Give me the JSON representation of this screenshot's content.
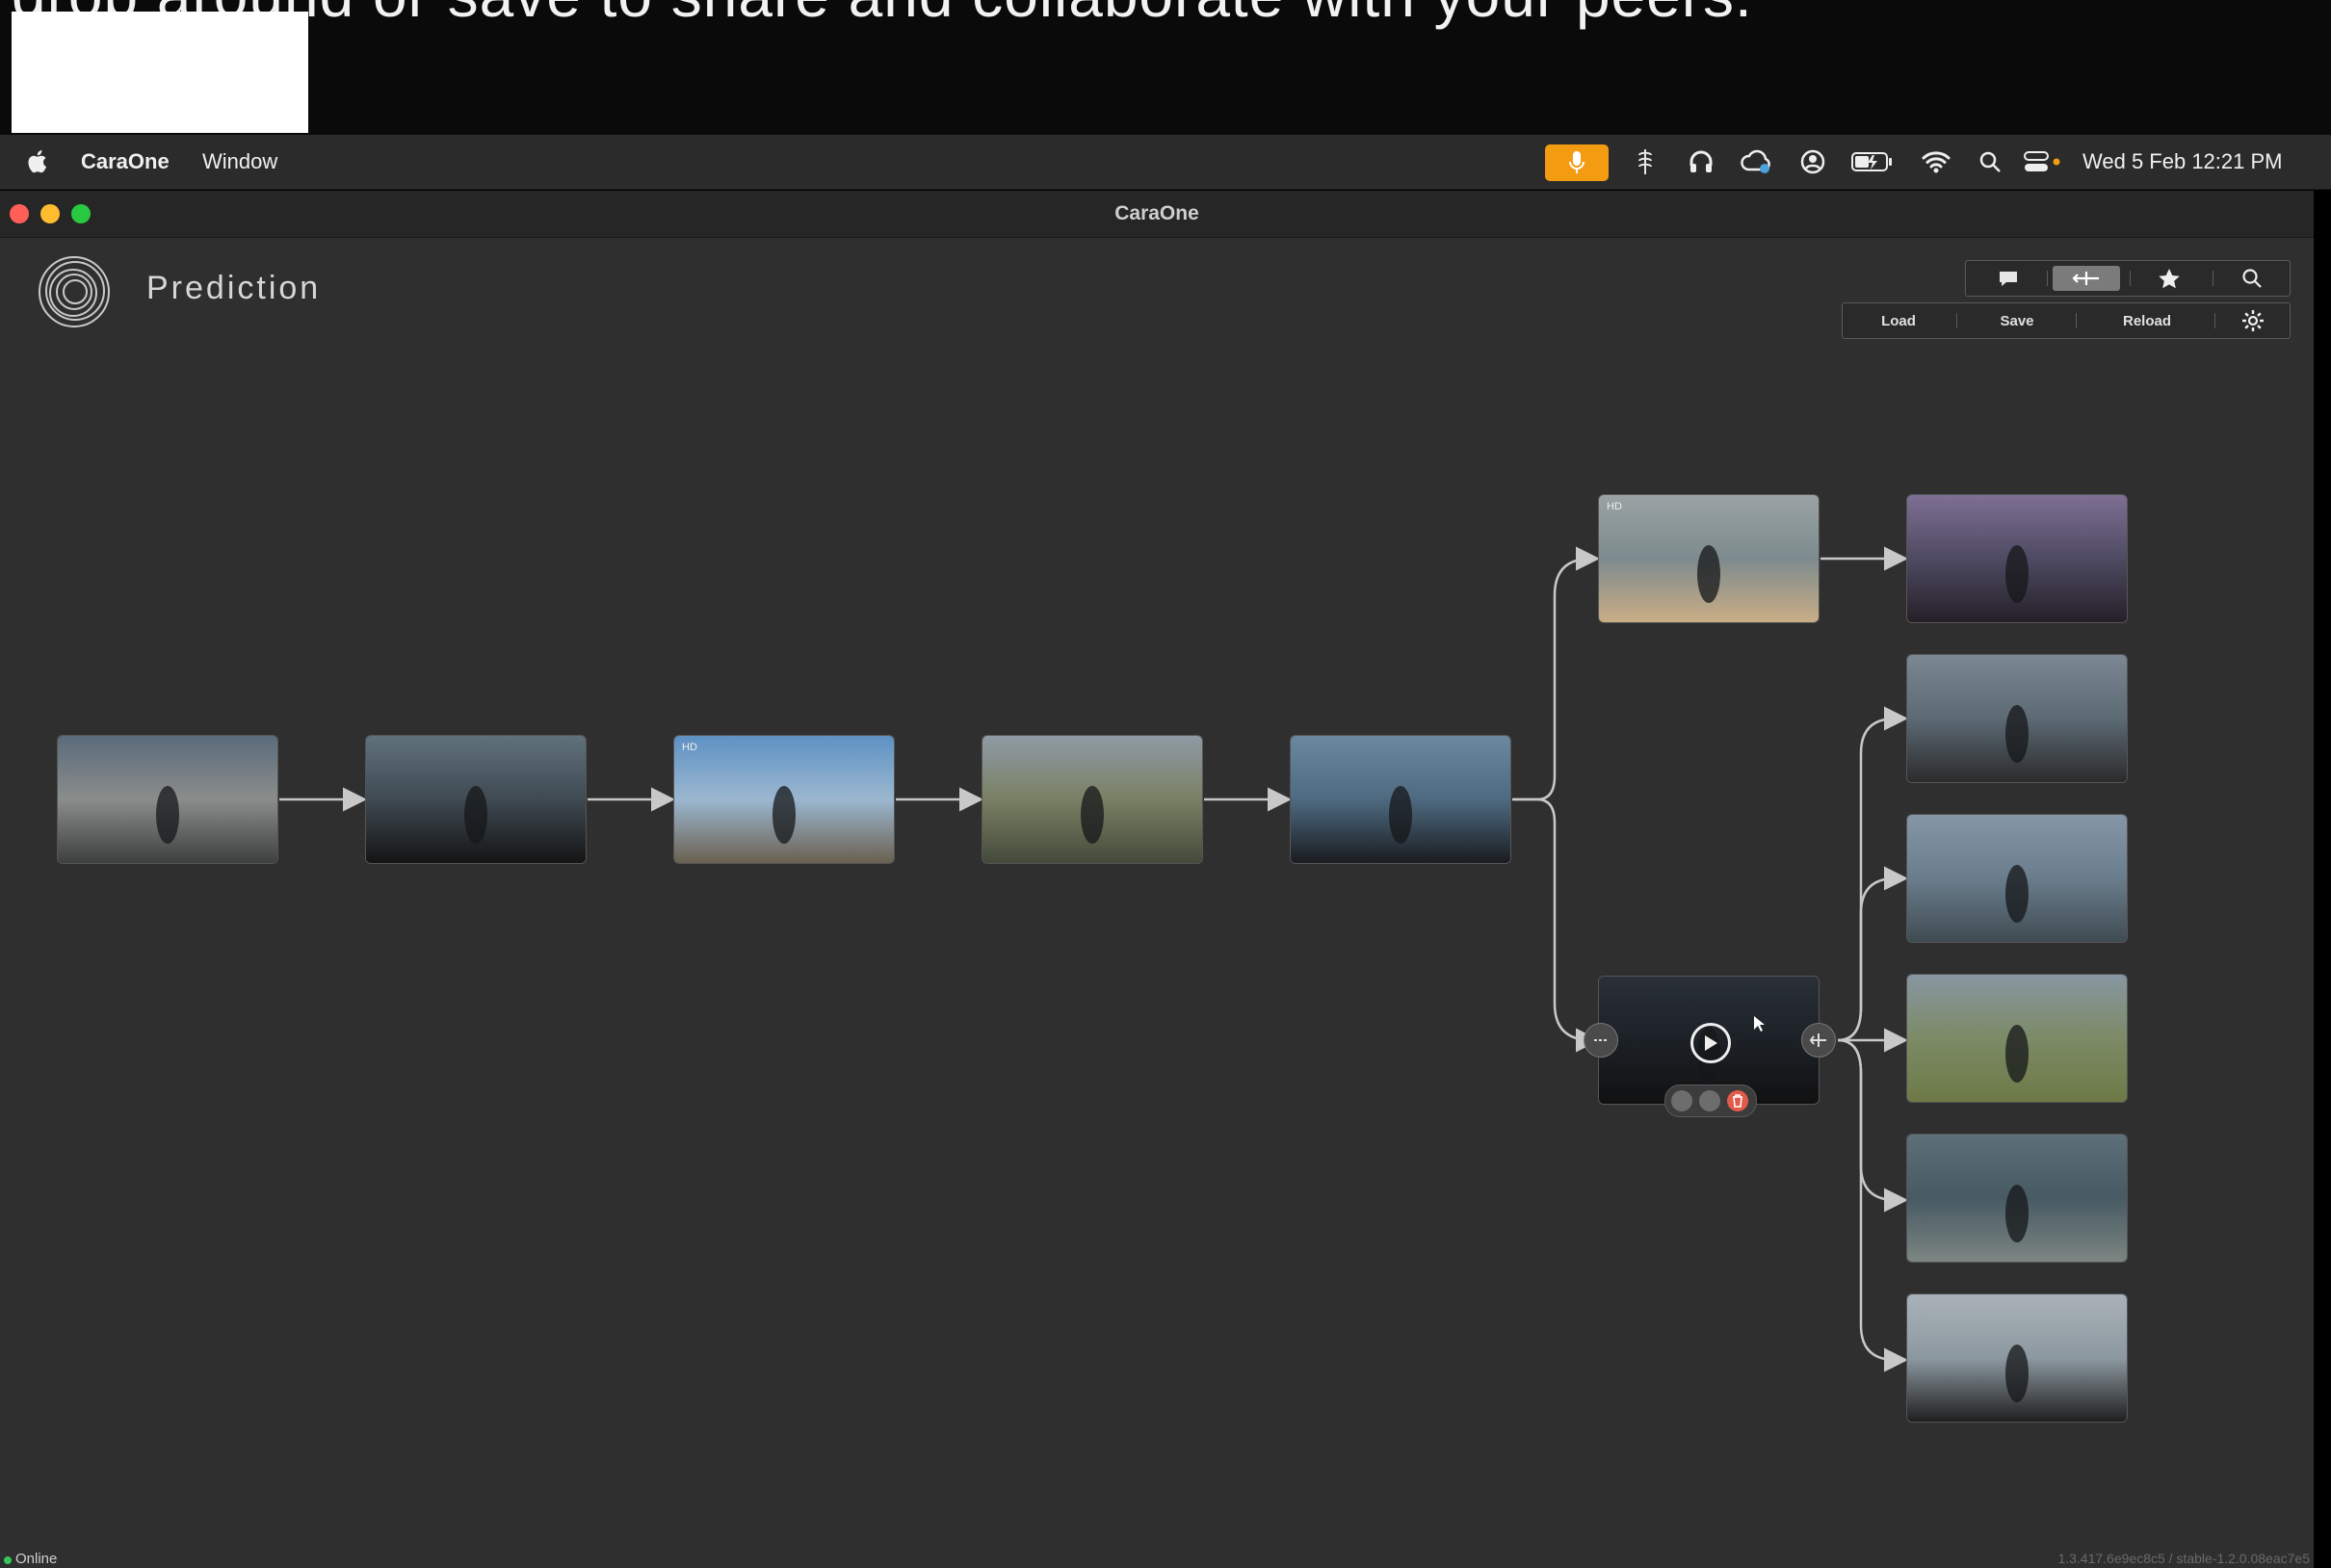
{
  "caption": {
    "text": "drop around or save to share and collaborate with your peers."
  },
  "menubar": {
    "app_name": "CaraOne",
    "menu_window": "Window",
    "clock": "Wed 5 Feb  12:21 PM",
    "icons": [
      "apple-icon",
      "microphone-icon",
      "drive-icon",
      "headphones-icon",
      "cloud-sync-icon",
      "user-icon",
      "battery-icon",
      "wifi-icon",
      "search-icon",
      "control-center-icon"
    ]
  },
  "window": {
    "title": "CaraOne"
  },
  "app": {
    "title": "Prediction",
    "logo_icon": "caraone-logo-icon"
  },
  "toolbar_top": {
    "icons": [
      "comment-icon",
      "compare-icon",
      "star-icon",
      "search-icon"
    ],
    "active_index": 1
  },
  "toolbar_bottom": {
    "load": "Load",
    "save": "Save",
    "reload": "Reload",
    "settings_icon": "gear-icon"
  },
  "graph": {
    "nodes": [
      {
        "id": "n1",
        "scene": "figure on beach with hills",
        "colors": [
          "#5b6b7a",
          "#8a8d8c",
          "#3d403f"
        ]
      },
      {
        "id": "n2",
        "scene": "man in hat profile",
        "colors": [
          "#60717c",
          "#3f4a52",
          "#141414"
        ]
      },
      {
        "id": "n3",
        "scene": "rocky coast waves",
        "colors": [
          "#5e91c4",
          "#9bb7cf",
          "#6a6050"
        ],
        "badge": "HD"
      },
      {
        "id": "n4",
        "scene": "man in tall grass",
        "colors": [
          "#8e9aa6",
          "#7a8064",
          "#444a3a"
        ]
      },
      {
        "id": "n5",
        "scene": "man facing lighthouse",
        "colors": [
          "#6b889f",
          "#4e6a80",
          "#1a1c20"
        ]
      },
      {
        "id": "n6",
        "scene": "aerial beach",
        "colors": [
          "#9aa3a4",
          "#7d8b8e",
          "#c9ad85"
        ],
        "badge": "HD"
      },
      {
        "id": "n7",
        "scene": "man in hat selected",
        "colors": [
          "#2a3038",
          "#1c2127",
          "#111"
        ],
        "selected": true
      },
      {
        "id": "n8",
        "scene": "purple sunset cliffs",
        "colors": [
          "#7e6f93",
          "#4e4a62",
          "#252028"
        ]
      },
      {
        "id": "n9",
        "scene": "man with glasses profile",
        "colors": [
          "#7b8792",
          "#5c6a74",
          "#2b2b2b"
        ]
      },
      {
        "id": "n10",
        "scene": "man on shoreline",
        "colors": [
          "#8597a6",
          "#6a7d8c",
          "#3f4b52"
        ]
      },
      {
        "id": "n11",
        "scene": "man in grass field",
        "colors": [
          "#8796a2",
          "#7c8a66",
          "#6d7a46"
        ]
      },
      {
        "id": "n12",
        "scene": "stormy beach figure",
        "colors": [
          "#5d6f78",
          "#475a63",
          "#7c8581"
        ]
      },
      {
        "id": "n13",
        "scene": "man in hat close-up",
        "colors": [
          "#a9b2b8",
          "#8c98a0",
          "#1f1f1f"
        ]
      }
    ],
    "selected_node_controls": [
      "play-icon",
      "link-icon",
      "branch-icon",
      "comment-icon",
      "image-icon",
      "delete-icon"
    ]
  },
  "status": {
    "online": "Online",
    "version": "1.3.417.6e9ec8c5 / stable-1.2.0.08eac7e5"
  },
  "colors": {
    "accent_orange": "#f39c12",
    "online_green": "#34c759",
    "delete_red": "#e25b4a"
  }
}
